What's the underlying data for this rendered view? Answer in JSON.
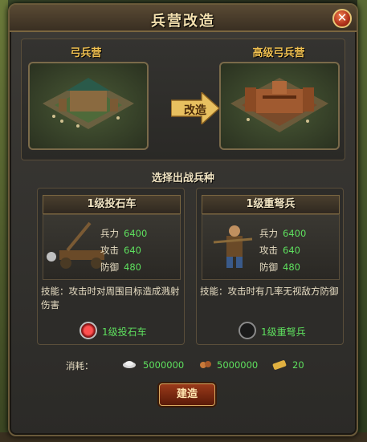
{
  "dialog": {
    "title": "兵营改造",
    "close_icon": "close-icon"
  },
  "upgrade": {
    "from_label": "弓兵营",
    "to_label": "高级弓兵营",
    "arrow_label": "改造"
  },
  "section_title": "选择出战兵种",
  "units": [
    {
      "name": "1级投石车",
      "stats": [
        {
          "label": "兵力",
          "value": "6400"
        },
        {
          "label": "攻击",
          "value": "640"
        },
        {
          "label": "防御",
          "value": "480"
        }
      ],
      "skill": "技能：攻击时对周围目标造成溅射伤害",
      "option_label": "1级投石车",
      "selected": true
    },
    {
      "name": "1级重弩兵",
      "stats": [
        {
          "label": "兵力",
          "value": "6400"
        },
        {
          "label": "攻击",
          "value": "640"
        },
        {
          "label": "防御",
          "value": "480"
        }
      ],
      "skill": "技能：攻击时有几率无视敌方防御",
      "option_label": "1级重弩兵",
      "selected": false
    }
  ],
  "cost": {
    "label": "消耗：",
    "silver": "5000000",
    "food": "5000000",
    "token": "20"
  },
  "build_button": "建造",
  "colors": {
    "accent_gold": "#f0c050",
    "value_green": "#5ee05e",
    "button_red": "#9a3a1a"
  }
}
